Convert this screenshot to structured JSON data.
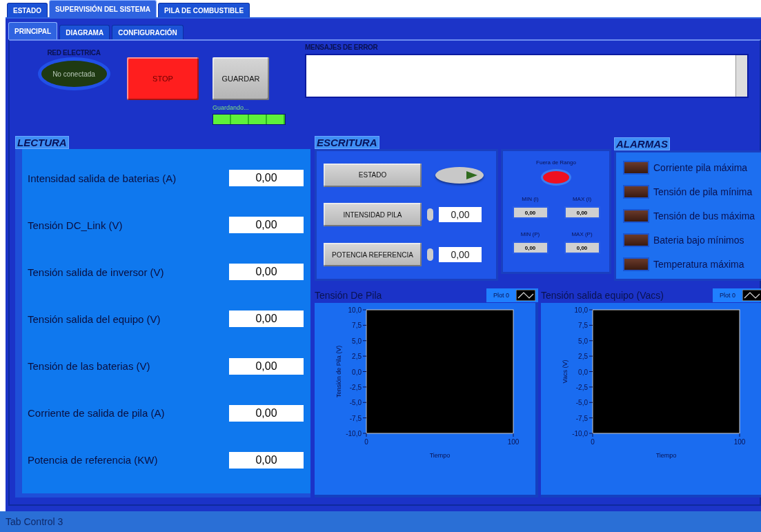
{
  "tabs": [
    {
      "label": "ESTADO",
      "selected": false
    },
    {
      "label": "SUPERVISIÓN DEL SISTEMA",
      "selected": true
    },
    {
      "label": "PILA DE COMBUSTIBLE",
      "selected": false
    }
  ],
  "subtabs": [
    {
      "label": "PRINCIPAL",
      "selected": true
    },
    {
      "label": "DIAGRAMA",
      "selected": false
    },
    {
      "label": "CONFIGURACIÓN",
      "selected": false
    }
  ],
  "red_electrica": {
    "label": "RED ELECTRICA",
    "status": "No conectada",
    "on": false
  },
  "stop_button": {
    "label": "STOP"
  },
  "save_button": {
    "label": "GUARDAR"
  },
  "saving": {
    "label": "Guardando...",
    "level": 1
  },
  "error_messages": {
    "label": "MENSAJES DE ERROR"
  },
  "lectura": {
    "title": "LECTURA",
    "rows": [
      {
        "label": "Intensidad salida de baterias (A)",
        "value": "0,00"
      },
      {
        "label": "Tensión DC_Link (V)",
        "value": "0,00"
      },
      {
        "label": "Tensión salida de inversor (V)",
        "value": "0,00"
      },
      {
        "label": "Tensión salida del equipo (V)",
        "value": "0,00"
      },
      {
        "label": "Tensión de las baterias (V)",
        "value": "0,00"
      },
      {
        "label": "Corriente de salida de pila (A)",
        "value": "0,00"
      },
      {
        "label": "Potencia de referencia (KW)",
        "value": "0,00"
      }
    ]
  },
  "escritura": {
    "title": "ESCRITURA",
    "estado_button": "ESTADO",
    "estado_switch": {
      "on": false
    },
    "controls": [
      {
        "label": "INTENSIDAD PILA",
        "value": "0,00"
      },
      {
        "label": "POTENCIA REFERENCIA",
        "value": "0,00"
      }
    ]
  },
  "range": {
    "label": "Fuera de Rango",
    "on": true,
    "limits": [
      {
        "label": "MIN (I)",
        "value": "0,00"
      },
      {
        "label": "MAX (I)",
        "value": "0,00"
      },
      {
        "label": "MIN (P)",
        "value": "0,00"
      },
      {
        "label": "MAX (P)",
        "value": "0,00"
      }
    ]
  },
  "alarmas": {
    "title": "ALARMAS",
    "items": [
      {
        "label": "Corriente pila máxima",
        "on": false
      },
      {
        "label": "Tensión de pila mínima",
        "on": false
      },
      {
        "label": "Tensión de bus máxima",
        "on": false
      },
      {
        "label": "Bateria bajo mínimos",
        "on": false
      },
      {
        "label": "Temperatura máxima",
        "on": false
      }
    ]
  },
  "charts": [
    {
      "title": "Tensión De Pila",
      "legend": "Plot 0",
      "xlabel": "Tiempo",
      "ylabel": "Tensión de Pila (V)",
      "x_tick_labels": [
        "0",
        "100"
      ],
      "y_tick_labels": [
        "10,0",
        "7,5",
        "5,0",
        "2,5",
        "0,0",
        "-2,5",
        "-5,0",
        "-7,5",
        "-10,0"
      ]
    },
    {
      "title": "Tensión salida equipo (Vacs)",
      "legend": "Plot 0",
      "xlabel": "Tiempo",
      "ylabel": "Vacs (V)",
      "x_tick_labels": [
        "0",
        "100"
      ],
      "y_tick_labels": [
        "10,0",
        "7,5",
        "5,0",
        "2,5",
        "0,0",
        "-2,5",
        "-5,0",
        "-7,5",
        "-10,0"
      ]
    }
  ],
  "status_bar": "Tab Control 3"
}
